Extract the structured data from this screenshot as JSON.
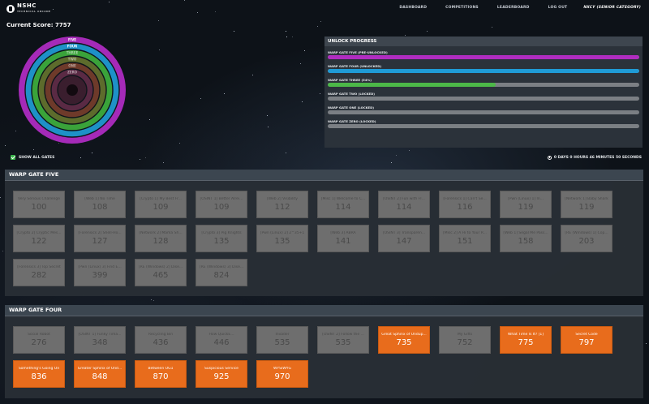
{
  "brand": {
    "name": "NSHC",
    "sub": "TECHNICAL ARCADE"
  },
  "nav": [
    "DASHBOARD",
    "COMPETITIONS",
    "LEADERBOARD",
    "LOG OUT"
  ],
  "user": "NXCY (SENIOR CATEGORY)",
  "score_label": "Current Score: 7757",
  "rings": [
    {
      "label": "FIVE",
      "color": "#a52ab8"
    },
    {
      "label": "FOUR",
      "color": "#1e91c7"
    },
    {
      "label": "THREE",
      "color": "#3aa33a"
    },
    {
      "label": "TWO",
      "color": "#5d6b2c"
    },
    {
      "label": "ONE",
      "color": "#6e3a2a"
    },
    {
      "label": "ZERO",
      "color": "#5a2a44"
    }
  ],
  "show_all_label": "SHOW ALL GATES",
  "unlock": {
    "title": "UNLOCK PROGRESS",
    "bars": [
      {
        "label": "WARP GATE FIVE (PRE-UNLOCKED)",
        "fraction": 1.0,
        "color": "#b02dc0"
      },
      {
        "label": "WARP GATE FOUR (UNLOCKED)",
        "fraction": 1.0,
        "color": "#1f9bd6"
      },
      {
        "label": "WARP GATE THREE (54%)",
        "fraction": 0.54,
        "color": "#4cb848"
      },
      {
        "label": "WARP GATE TWO (LOCKED)",
        "fraction": 0,
        "color": "#7b7f84"
      },
      {
        "label": "WARP GATE ONE (LOCKED)",
        "fraction": 0,
        "color": "#7b7f84"
      },
      {
        "label": "WARP GATE ZERO (LOCKED)",
        "fraction": 0,
        "color": "#7b7f84"
      }
    ]
  },
  "timer": "0 DAYS 0 HOURS 46 MINUTES 50 SECONDS",
  "gate_five": {
    "title": "WARP GATE FIVE",
    "tiles": [
      {
        "name": "Very Serious Challenge",
        "points": "100",
        "open": false
      },
      {
        "name": "[Web 1] No Time",
        "points": "108",
        "open": false
      },
      {
        "name": "[Crypto 1] My Best Fr...",
        "points": "109",
        "open": false
      },
      {
        "name": "[OSINT 1] Better Alrei...",
        "points": "109",
        "open": false
      },
      {
        "name": "[Web 2] Visibility",
        "points": "112",
        "open": false
      },
      {
        "name": "[Misc 1] Welcome to C...",
        "points": "114",
        "open": false
      },
      {
        "name": "[OSINT 2] Fun with Fl...",
        "points": "114",
        "open": false
      },
      {
        "name": "[Forensics 1] Can't Se...",
        "points": "116",
        "open": false
      },
      {
        "name": "[Pwn (Linux) 1] In...",
        "points": "119",
        "open": false
      },
      {
        "name": "[Network 1] Baby Shark",
        "points": "119",
        "open": false
      },
      {
        "name": "[Crypto 2] Cryptic Mes...",
        "points": "122",
        "open": false
      },
      {
        "name": "[Forensics 2] Shell-Ho...",
        "points": "127",
        "open": false
      },
      {
        "name": "[Network 2] Mama Sh...",
        "points": "128",
        "open": false
      },
      {
        "name": "[Crypto 3] Pig Knights",
        "points": "135",
        "open": false
      },
      {
        "name": "[Pwn (Linux) 2] 2^35+1",
        "points": "135",
        "open": false
      },
      {
        "name": "[Web 3] ABRA",
        "points": "141",
        "open": false
      },
      {
        "name": "[OSINT 3] Transparen...",
        "points": "147",
        "open": false
      },
      {
        "name": "[Misc 2] A Hi to Your R...",
        "points": "151",
        "open": false
      },
      {
        "name": "[Web 1] Segal Me Pass...",
        "points": "158",
        "open": false
      },
      {
        "name": "[RE (Windows) 1] Cop...",
        "points": "203",
        "open": false
      },
      {
        "name": "[Forensics 3] Top Secret",
        "points": "282",
        "open": false
      },
      {
        "name": "[Pwn (Linux) 3] Find E...",
        "points": "399",
        "open": false
      },
      {
        "name": "[RE (Windows) 2] Dise...",
        "points": "465",
        "open": false
      },
      {
        "name": "[RE (Windows) 3] Dise...",
        "points": "824",
        "open": false
      }
    ]
  },
  "gate_four": {
    "title": "WARP GATE FOUR",
    "tiles": [
      {
        "name": "Social Robot",
        "points": "276",
        "open": false
      },
      {
        "name": "[OSINT 1] Funky Tima...",
        "points": "348",
        "open": false
      },
      {
        "name": "Recycling Bin",
        "points": "436",
        "open": false
      },
      {
        "name": "How QuickE...",
        "points": "446",
        "open": false
      },
      {
        "name": "Invader",
        "points": "535",
        "open": false
      },
      {
        "name": "[OSINT 2] Follow the ...",
        "points": "535",
        "open": false
      },
      {
        "name": "Great Sphinx of Undup...",
        "points": "735",
        "open": true
      },
      {
        "name": "My Gifts",
        "points": "752",
        "open": false
      },
      {
        "name": "What Time Is It? [1]",
        "points": "775",
        "open": true
      },
      {
        "name": "Secret Code",
        "points": "797",
        "open": true
      },
      {
        "name": "Something's Going On",
        "points": "836",
        "open": true
      },
      {
        "name": "Greater Sphinx of Und...",
        "points": "848",
        "open": true
      },
      {
        "name": "Between OG1",
        "points": "870",
        "open": true
      },
      {
        "name": "Suspicious Service",
        "points": "925",
        "open": true
      },
      {
        "name": "WYSIWYG",
        "points": "970",
        "open": true
      }
    ]
  }
}
